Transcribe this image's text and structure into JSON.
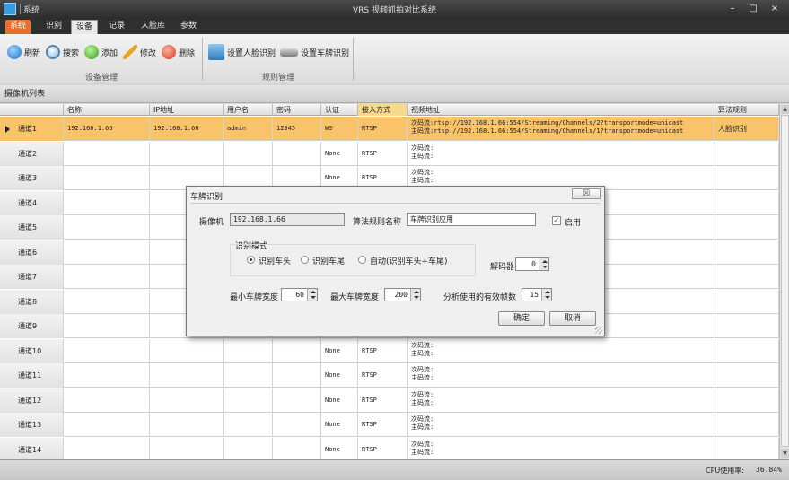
{
  "window": {
    "system_menu": "系统",
    "title": "VRS 视频抓拍对比系统",
    "minimize": "–",
    "maximize": "□",
    "close": "×"
  },
  "tabs": [
    "系统",
    "识别",
    "设备",
    "记录",
    "人脸库",
    "参数"
  ],
  "active_tab": "设备",
  "ribbon": {
    "device_group": {
      "label": "设备管理",
      "buttons": [
        "刷新",
        "搜索",
        "添加",
        "修改",
        "删除"
      ]
    },
    "rule_group": {
      "label": "规则管理",
      "buttons": [
        "设置人脸识别",
        "设置车牌识别"
      ]
    }
  },
  "section_title": "摄像机列表",
  "columns": [
    "名称",
    "IP地址",
    "用户名",
    "密码",
    "认证",
    "接入方式",
    "视频地址",
    "算法规则"
  ],
  "rows": [
    {
      "name": "通道1",
      "ip": "192.168.1.66",
      "user": "admin",
      "password": "12345",
      "auth": "WS",
      "access": "RTSP",
      "sub": "次码流:rtsp://192.168.1.66:554/Streaming/Channels/2?transportmode=unicast",
      "main": "主码流:rtsp://192.168.1.66:554/Streaming/Channels/1?transportmode=unicast",
      "algo": "人脸识别"
    },
    {
      "name": "通道2",
      "ip": "",
      "user": "",
      "password": "",
      "auth": "None",
      "access": "RTSP",
      "sub": "次码流:",
      "main": "主码流:",
      "algo": ""
    },
    {
      "name": "通道3",
      "ip": "",
      "user": "",
      "password": "",
      "auth": "None",
      "access": "RTSP",
      "sub": "次码流:",
      "main": "主码流:",
      "algo": ""
    },
    {
      "name": "通道4",
      "ip": "",
      "user": "",
      "password": "",
      "auth": "",
      "access": "",
      "sub": "",
      "main": "",
      "algo": ""
    },
    {
      "name": "通道5",
      "ip": "",
      "user": "",
      "password": "",
      "auth": "",
      "access": "",
      "sub": "",
      "main": "",
      "algo": ""
    },
    {
      "name": "通道6",
      "ip": "",
      "user": "",
      "password": "",
      "auth": "",
      "access": "",
      "sub": "",
      "main": "",
      "algo": ""
    },
    {
      "name": "通道7",
      "ip": "",
      "user": "",
      "password": "",
      "auth": "",
      "access": "",
      "sub": "",
      "main": "",
      "algo": ""
    },
    {
      "name": "通道8",
      "ip": "",
      "user": "",
      "password": "",
      "auth": "",
      "access": "",
      "sub": "",
      "main": "",
      "algo": ""
    },
    {
      "name": "通道9",
      "ip": "",
      "user": "",
      "password": "",
      "auth": "",
      "access": "",
      "sub": "",
      "main": "",
      "algo": ""
    },
    {
      "name": "通道10",
      "ip": "",
      "user": "",
      "password": "",
      "auth": "None",
      "access": "RTSP",
      "sub": "次码流:",
      "main": "主码流:",
      "algo": ""
    },
    {
      "name": "通道11",
      "ip": "",
      "user": "",
      "password": "",
      "auth": "None",
      "access": "RTSP",
      "sub": "次码流:",
      "main": "主码流:",
      "algo": ""
    },
    {
      "name": "通道12",
      "ip": "",
      "user": "",
      "password": "",
      "auth": "None",
      "access": "RTSP",
      "sub": "次码流:",
      "main": "主码流:",
      "algo": ""
    },
    {
      "name": "通道13",
      "ip": "",
      "user": "",
      "password": "",
      "auth": "None",
      "access": "RTSP",
      "sub": "次码流:",
      "main": "主码流:",
      "algo": ""
    },
    {
      "name": "通道14",
      "ip": "",
      "user": "",
      "password": "",
      "auth": "None",
      "access": "RTSP",
      "sub": "次码流:",
      "main": "主码流:",
      "algo": ""
    }
  ],
  "dialog": {
    "title": "车牌识别",
    "close_label": "☒",
    "camera_label": "摄像机",
    "camera_value": "192.168.1.66",
    "rule_name_label": "算法规则名称",
    "rule_name_value": "车牌识别应用",
    "enable_label": "启用",
    "enable_checked": true,
    "mode_label": "识别模式",
    "modes": [
      "识别车头",
      "识别车尾",
      "自动(识别车头+车尾)"
    ],
    "selected_mode": "识别车头",
    "decoder_label": "解码器",
    "decoder_value": "0",
    "min_width_label": "最小车牌宽度",
    "min_width_value": "60",
    "max_width_label": "最大车牌宽度",
    "max_width_value": "200",
    "frames_label": "分析使用的有效帧数",
    "frames_value": "15",
    "ok_label": "确定",
    "cancel_label": "取消"
  },
  "status": {
    "cpu_label": "CPU使用率:",
    "cpu_value": "36.84%"
  },
  "colors": {
    "system_tab": "#e8702a",
    "selected_row": "#f9c36a",
    "highlight_header": "#f7d98e"
  }
}
